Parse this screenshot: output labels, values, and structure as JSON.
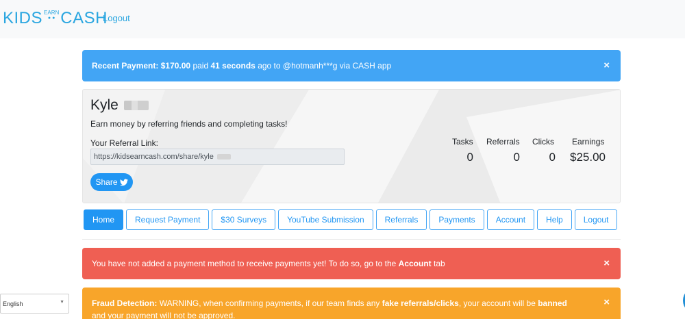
{
  "nav": {
    "logo_kids": "KIDS",
    "logo_earn": "EARN",
    "logo_cash": "CASH",
    "logout": "Logout"
  },
  "recent_payment": {
    "label": "Recent Payment:",
    "amount": "$170.00",
    "text1": "paid",
    "time": "41 seconds",
    "text2": "ago to @hotmanh***g via CASH app",
    "close": "×"
  },
  "profile": {
    "name": "Kyle",
    "tagline": "Earn money by referring friends and completing tasks!",
    "referral_label": "Your Referral Link:",
    "referral_link": "https://kidsearncash.com/share/kyle",
    "share_label": "Share"
  },
  "stats": {
    "tasks_label": "Tasks",
    "tasks_value": "0",
    "referrals_label": "Referrals",
    "referrals_value": "0",
    "clicks_label": "Clicks",
    "clicks_value": "0",
    "earnings_label": "Earnings",
    "earnings_value": "$25.00"
  },
  "tabs": [
    {
      "label": "Home"
    },
    {
      "label": "Request Payment"
    },
    {
      "label": "$30 Surveys"
    },
    {
      "label": "YouTube Submission"
    },
    {
      "label": "Referrals"
    },
    {
      "label": "Payments"
    },
    {
      "label": "Account"
    },
    {
      "label": "Help"
    },
    {
      "label": "Logout"
    }
  ],
  "payment_alert": {
    "text": "You have not added a payment method to receive payments yet! To do so, go to the",
    "bold": "Account",
    "suffix": "tab",
    "close": "×"
  },
  "fraud_alert": {
    "label": "Fraud Detection:",
    "text1": "WARNING, when confirming payments, if our team finds any",
    "bold1": "fake referrals/clicks",
    "text2": ", your account will be",
    "bold2": "banned",
    "text3": "and your payment will not be approved.",
    "close": "×"
  },
  "language": {
    "selected": "English"
  },
  "colors": {
    "brand": "#2aa6e0",
    "primary": "#2196f3",
    "info": "#42a5f5",
    "danger": "#ef5f53",
    "warning": "#f8a52a"
  },
  "icons": {
    "share": "twitter-icon",
    "select": "chevron-down-icon"
  }
}
